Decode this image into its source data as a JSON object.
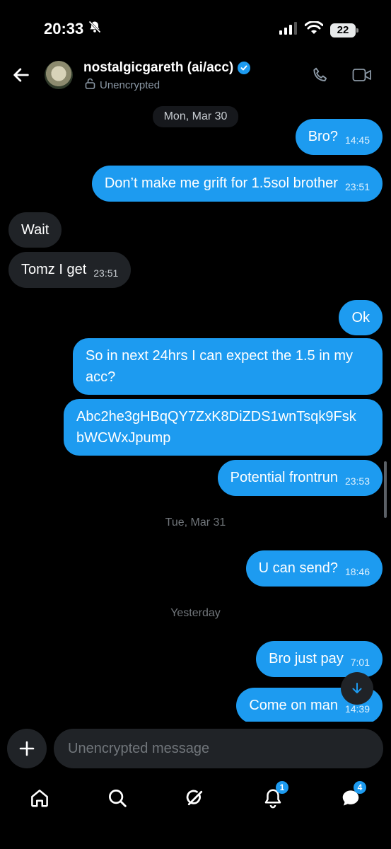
{
  "status_bar": {
    "time": "20:33",
    "battery": "22",
    "icons": [
      "bell-slash-icon",
      "signal-icon",
      "wifi-icon",
      "battery-icon"
    ]
  },
  "header": {
    "contact_name": "nostalgicgareth (ai/acc)",
    "encryption_status": "Unencrypted",
    "icons": [
      "back-arrow-icon",
      "verified-badge-icon",
      "lock-open-icon",
      "phone-icon",
      "video-icon"
    ]
  },
  "messages": {
    "day1": "Mon, Mar 30",
    "m1_text": "Bro?",
    "m1_time": "14:45",
    "m2_text": "Don’t make me grift for 1.5sol brother",
    "m2_time": "23:51",
    "m3_text": "Wait",
    "m4_text": "Tomz I get",
    "m4_time": "23:51",
    "m5_text": "Ok",
    "m6_line1": "So in next 24hrs I can expect the 1.5 in my",
    "m6_line2": "acc?",
    "m7_line1": "Abc2he3gHBqQY7ZxK8DiZDS1wnTsqk9Fsk",
    "m7_line2": "bWCWxJpump",
    "m8_text": "Potential frontrun",
    "m8_time": "23:53",
    "day2": "Tue, Mar 31",
    "m9_text": "U can send?",
    "m9_time": "18:46",
    "day3": "Yesterday",
    "m10_text": "Bro just pay",
    "m10_time": "7:01",
    "m11_text": "Come on man",
    "m11_time": "14:39"
  },
  "composer": {
    "placeholder": "Unencrypted message"
  },
  "bottom_nav": {
    "items": [
      "home-icon",
      "search-icon",
      "grok-icon",
      "notifications-icon",
      "messages-icon"
    ],
    "notifications_badge": "1",
    "messages_badge": "4"
  },
  "colors": {
    "accent": "#1d9bf0",
    "incoming_bubble": "#202327",
    "background": "#000000"
  }
}
